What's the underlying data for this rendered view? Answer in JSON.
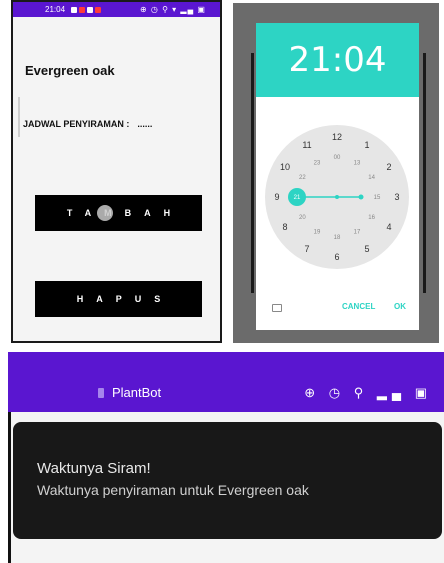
{
  "screen1": {
    "status_time": "21:04",
    "status_icons": "⊕ ◷ ⚲ ▾ ▂▄ ▣",
    "plant_name": "Evergreen oak",
    "schedule_label": "JADWAL PENYIRAMAN :",
    "schedule_value": "......",
    "add_button": "TAMBAH",
    "delete_button": "HAPUS"
  },
  "picker": {
    "time": "21:04",
    "outer_hours": [
      "12",
      "1",
      "2",
      "3",
      "4",
      "5",
      "6",
      "7",
      "8",
      "9",
      "10",
      "11"
    ],
    "inner_hours": [
      "00",
      "13",
      "14",
      "15",
      "16",
      "17",
      "18",
      "19",
      "20",
      "21",
      "22",
      "23"
    ],
    "selected_hour": "21",
    "cancel": "CANCEL",
    "ok": "OK",
    "accent": "#2dd4c4"
  },
  "screen2": {
    "app_name": "PlantBot",
    "status_icons": "⊕ ◷ ⚲ ▂▄ ▣",
    "notif_title": "Waktunya Siram!",
    "notif_body": "Waktunya penyiraman untuk Evergreen oak"
  },
  "colors": {
    "primary": "#5a16d0",
    "button": "#000000",
    "notification_bg": "#181818"
  }
}
